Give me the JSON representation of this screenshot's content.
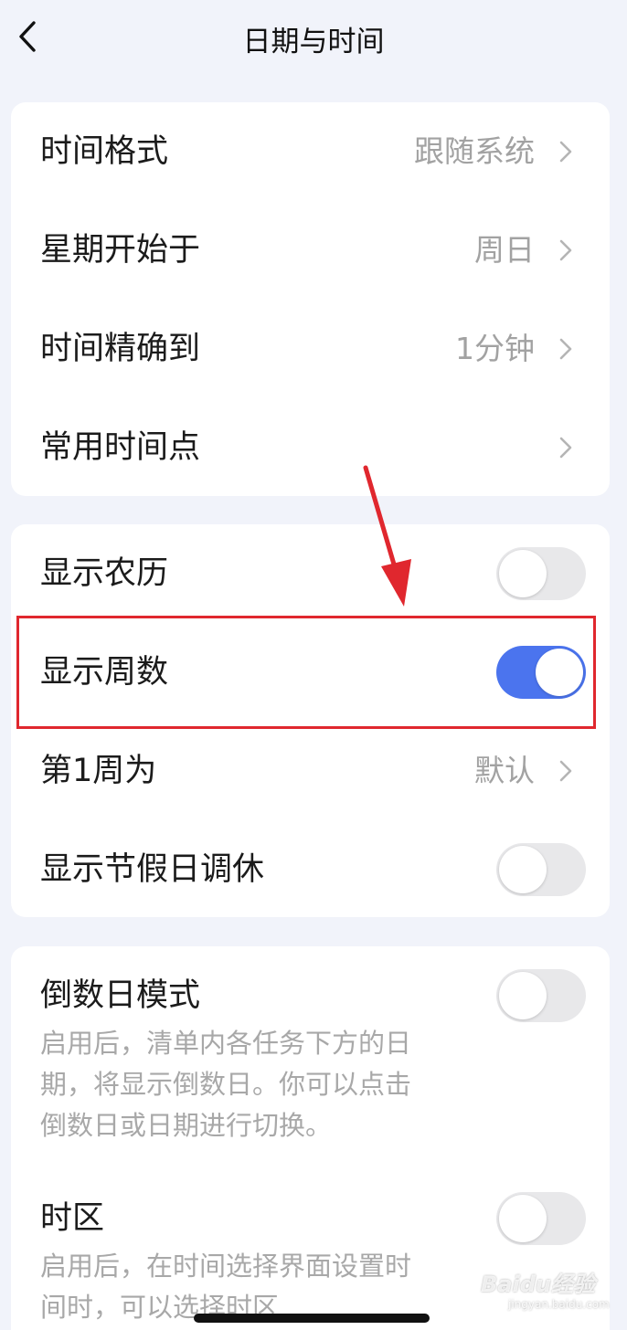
{
  "header": {
    "title": "日期与时间",
    "back_icon": "chevron-left-icon"
  },
  "section1": {
    "time_format": {
      "label": "时间格式",
      "value": "跟随系统"
    },
    "week_start": {
      "label": "星期开始于",
      "value": "周日"
    },
    "time_precision": {
      "label": "时间精确到",
      "value": "1分钟"
    },
    "common_times": {
      "label": "常用时间点"
    }
  },
  "section2": {
    "show_lunar": {
      "label": "显示农历",
      "enabled": false
    },
    "show_week_number": {
      "label": "显示周数",
      "enabled": true
    },
    "first_week": {
      "label": "第1周为",
      "value": "默认"
    },
    "show_holiday": {
      "label": "显示节假日调休",
      "enabled": false
    }
  },
  "section3": {
    "countdown": {
      "label": "倒数日模式",
      "enabled": false,
      "description_lines": [
        "启用后，清单内各任务下方的日",
        "期，将显示倒数日。你可以点击",
        "倒数日或日期进行切换。"
      ]
    },
    "timezone": {
      "label": "时区",
      "enabled": false,
      "description_lines": [
        "启用后，在时间选择界面设置时",
        "间时，可以选择时区"
      ]
    }
  },
  "watermark": {
    "brand": "Baidu经验",
    "url": "jingyan.baidu.com"
  },
  "colors": {
    "background": "#f1f3fa",
    "accent": "#4b74ee",
    "toggle_off": "#e8e8ea",
    "annotation": "#e0272e"
  }
}
